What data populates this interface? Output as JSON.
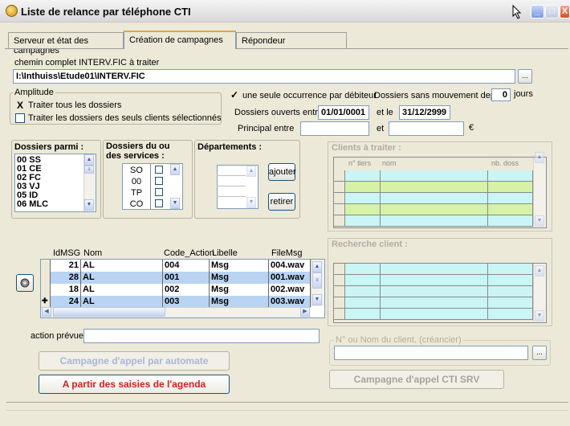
{
  "window": {
    "title": "Liste de relance par téléphone  CTI",
    "min_label": "_",
    "max_label": "□",
    "close_label": "X"
  },
  "tabs": [
    {
      "label": "Serveur et état des campagnes"
    },
    {
      "label": "Création de campagnes"
    },
    {
      "label": "Répondeur"
    }
  ],
  "path": {
    "label": "chemin complet INTERV.FIC à traiter",
    "value": "I:\\Inthuiss\\Etude01\\INTERV.FIC",
    "browse": "..."
  },
  "amplitude": {
    "legend": "Amplitude",
    "option1": {
      "label": "Traiter tous les dossiers",
      "mark": "X"
    },
    "option2": {
      "label": "Traiter les dossiers des seuls clients sélectionnés"
    }
  },
  "options": {
    "seule_occurrence": {
      "label": "une seule occurrence par débiteur",
      "mark": "✓"
    },
    "sans_mouvement_label": "Dossiers sans mouvement depuis",
    "sans_mouvement_value": "0",
    "jours": "jours",
    "ouverts_label": "Dossiers ouverts entre le",
    "ouverts_from": "01/01/0001",
    "et_le": "et le",
    "ouverts_to": "31/12/2999",
    "principal_label": "Principal entre",
    "principal_et": "et",
    "euro": "€"
  },
  "dossiers_parmi": {
    "label": "Dossiers parmi :",
    "items": [
      "00 SS",
      "01 CE",
      "02 FC",
      "03 VJ",
      "05 ID",
      "06 MLC"
    ]
  },
  "services": {
    "label": "Dossiers du ou des services :",
    "items": [
      "SO",
      "00",
      "TP",
      "CO"
    ]
  },
  "departements": {
    "label": "Départements :",
    "ajouter": "ajouter",
    "retirer": "retirer"
  },
  "clients_traiter": {
    "label": "Clients à traiter :",
    "columns": [
      "n° tiers",
      "nom",
      "nb. doss"
    ]
  },
  "recherche_client": {
    "label": "Recherche client :"
  },
  "messages": {
    "columns": [
      "IdMSG",
      "Nom",
      "Code_Action",
      "Libelle",
      "FileMsg"
    ],
    "rows": [
      {
        "id": "21",
        "nom": "AL",
        "code": "004",
        "libelle": "Msg",
        "file": "004.wav"
      },
      {
        "id": "28",
        "nom": "AL",
        "code": "001",
        "libelle": "Msg",
        "file": "001.wav"
      },
      {
        "id": "18",
        "nom": "AL",
        "code": "002",
        "libelle": "Msg",
        "file": "002.wav"
      },
      {
        "id": "24",
        "nom": "AL",
        "code": "003",
        "libelle": "Msg",
        "file": "003.wav"
      }
    ],
    "current_marker": "✚"
  },
  "action": {
    "label": "action prévue",
    "value": ""
  },
  "client_search": {
    "legend": "N° ou Nom du client. (créancier)",
    "browse": "..."
  },
  "buttons": {
    "automate": "Campagne d'appel par automate",
    "agenda": "A partir des saisies de l'agenda",
    "cti": "Campagne d'appel CTI SRV"
  },
  "colors": {
    "row_blue": "#B9D3F2",
    "row_white": "#FFFFFF",
    "grid_cyan": "#C9F5F5",
    "grid_green": "#D6F2A6",
    "agenda_red": "#D31E1E"
  }
}
